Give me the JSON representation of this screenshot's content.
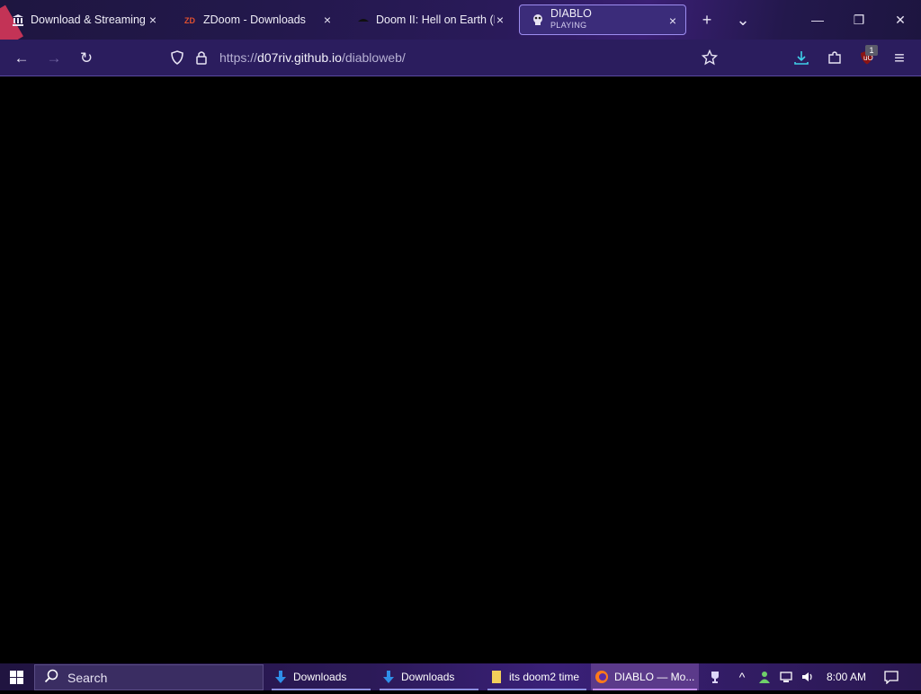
{
  "tabs": [
    {
      "title": "Download & Streaming : In",
      "icon": "library-icon"
    },
    {
      "title": "ZDoom - Downloads",
      "icon": "zdoom-icon"
    },
    {
      "title": "Doom II: Hell on Earth (D",
      "icon": "doom-icon"
    },
    {
      "title": "DIABLO",
      "subtitle": "PLAYING",
      "icon": "diablo-icon",
      "active": true
    }
  ],
  "tab_close_glyph": "×",
  "new_tab_glyph": "+",
  "list_tabs_glyph": "⌄",
  "window_controls": {
    "minimize": "—",
    "restore": "❐",
    "close": "✕"
  },
  "navigation": {
    "back": "←",
    "forward": "→",
    "reload": "↻"
  },
  "url": {
    "scheme": "https://",
    "host": "d07riv.github.io",
    "path": "/diabloweb/"
  },
  "toolbar": {
    "badge_count": "1",
    "menu": "≡"
  },
  "taskbar": {
    "search_placeholder": "Search",
    "items": [
      {
        "label": "Downloads"
      },
      {
        "label": "Downloads"
      },
      {
        "label": "its doom2 time"
      },
      {
        "label": "DIABLO — Mo...",
        "active": true
      }
    ],
    "clock": "8:00 AM"
  },
  "colors": {
    "accent": "#9d8df0",
    "tabbar": "#23184c",
    "navbar": "#2b1d5e",
    "content": "#000000"
  }
}
